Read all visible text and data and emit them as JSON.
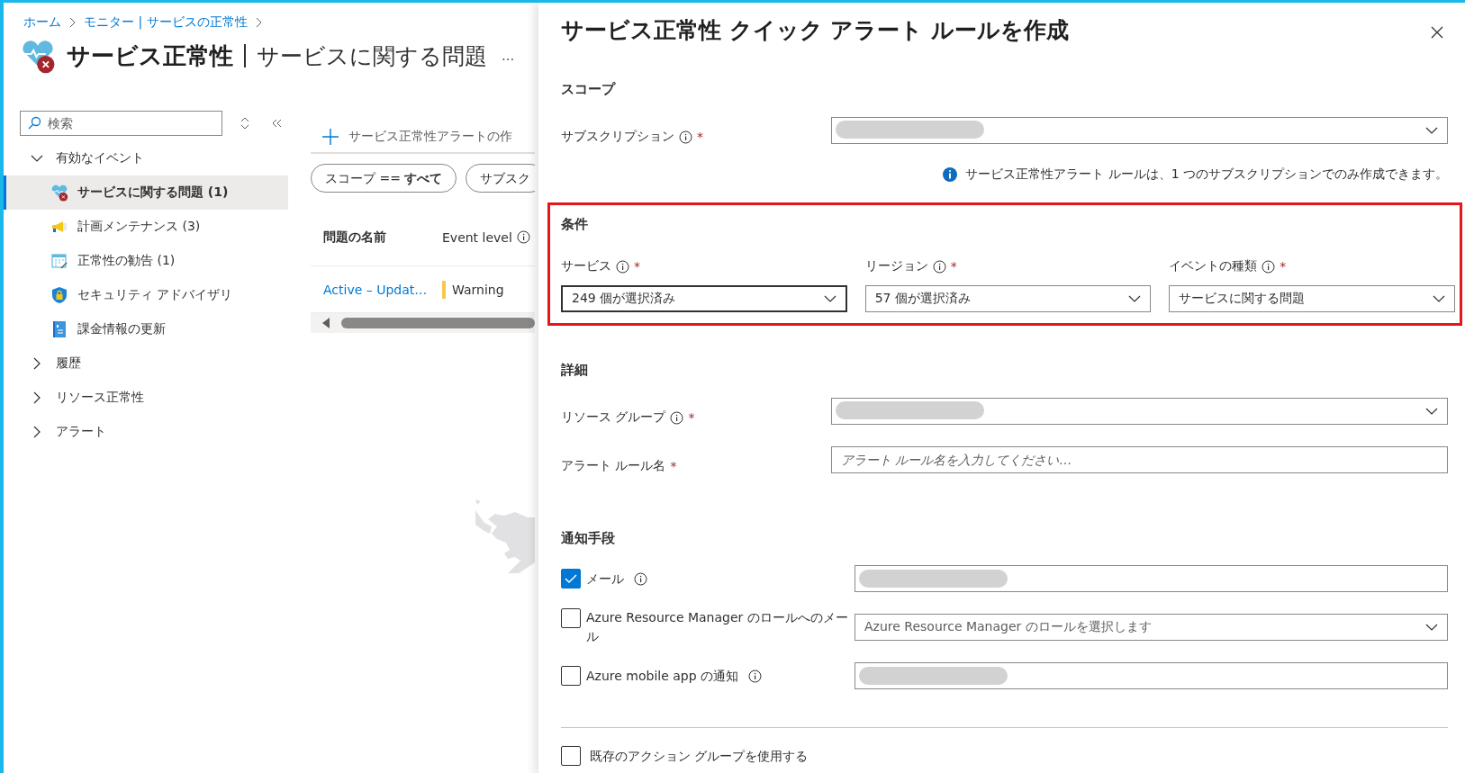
{
  "breadcrumb": [
    {
      "label": "ホーム"
    },
    {
      "label": "モニター | サービスの正常性"
    }
  ],
  "header": {
    "title": "サービス正常性",
    "subtitle": "サービスに関する問題",
    "more": "..."
  },
  "sidebar": {
    "search": {
      "placeholder": "検索"
    },
    "items": [
      {
        "label": "有効なイベント",
        "expanded": true,
        "children": [
          {
            "label": "サービスに関する問題 (1)",
            "kind": "health",
            "selected": true
          },
          {
            "label": "計画メンテナンス (3)",
            "kind": "megaphone",
            "selected": false
          },
          {
            "label": "正常性の勧告 (1)",
            "kind": "calendar",
            "selected": false
          },
          {
            "label": "セキュリティ アドバイザリ",
            "kind": "shield",
            "selected": false
          },
          {
            "label": "課金情報の更新",
            "kind": "billing",
            "selected": false
          }
        ]
      },
      {
        "label": "履歴",
        "expanded": false
      },
      {
        "label": "リソース正常性",
        "expanded": false
      },
      {
        "label": "アラート",
        "expanded": false
      }
    ]
  },
  "toolbar": {
    "create": "サービス正常性アラートの作"
  },
  "filters": [
    {
      "label": "スコープ == **すべて**"
    },
    {
      "label": "サブスク"
    }
  ],
  "table": {
    "columns": [
      {
        "label": "問題の名前",
        "info": false
      },
      {
        "label": "Event level",
        "info": true
      }
    ],
    "rows": [
      {
        "name": "Active – Updat…",
        "level": "Warning",
        "color": "#f7c948"
      }
    ]
  },
  "panel": {
    "title": "サービス正常性 クイック アラート ルールを作成",
    "sections": [
      {
        "heading": "スコープ",
        "highlighted": false,
        "kind": "rows",
        "fields": [
          {
            "kind": "dropdown",
            "label": "サブスクリプション",
            "info": true,
            "required": "*",
            "redacted": true
          }
        ],
        "note": "サービス正常性アラート ルールは、1 つのサブスクリプションでのみ作成できます。"
      },
      {
        "heading": "条件",
        "highlighted": true,
        "kind": "columns",
        "fields": [
          {
            "kind": "dropdown",
            "label": "サービス",
            "info": true,
            "required": "*",
            "value": "249 個が選択済み",
            "focused": true
          },
          {
            "kind": "dropdown",
            "label": "リージョン",
            "info": true,
            "required": "*",
            "value": "57 個が選択済み",
            "focused": false
          },
          {
            "kind": "dropdown",
            "label": "イベントの種類",
            "info": true,
            "required": "*",
            "value": "サービスに関する問題",
            "focused": false
          }
        ]
      },
      {
        "heading": "詳細",
        "highlighted": false,
        "kind": "rows",
        "fields": [
          {
            "kind": "dropdown",
            "label": "リソース グループ",
            "info": true,
            "required": "*",
            "redacted": true
          },
          {
            "kind": "input",
            "label": "アラート ルール名",
            "info": false,
            "required": "*",
            "placeholder": "アラート ルール名を入力してください…"
          }
        ]
      },
      {
        "heading": "通知手段",
        "highlighted": false,
        "kind": "checks",
        "fields": [
          {
            "kind": "input",
            "label": "メール",
            "info": true,
            "checked": true,
            "redacted": true
          },
          {
            "kind": "dropdown",
            "label": "Azure Resource Manager のロールへのメール",
            "info": false,
            "checked": false,
            "placeholder": "Azure Resource Manager のロールを選択します"
          },
          {
            "kind": "input",
            "label": "Azure mobile app の通知",
            "info": true,
            "checked": false,
            "redacted": true
          }
        ]
      }
    ],
    "options": [
      {
        "label": "既存のアクション グループを使用する",
        "checked": false
      }
    ]
  }
}
